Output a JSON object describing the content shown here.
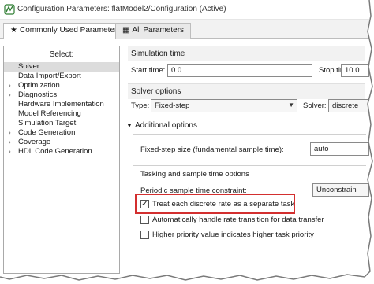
{
  "window": {
    "title": "Configuration Parameters: flatModel2/Configuration (Active)"
  },
  "tabs": [
    {
      "label": "Commonly Used Parameters",
      "glyph": "★",
      "icon": "star-icon"
    },
    {
      "label": "All Parameters",
      "glyph": "▦",
      "icon": "grid-icon"
    }
  ],
  "tree": {
    "header": "Select:",
    "items": [
      {
        "label": "Solver",
        "expandable": false,
        "selected": true
      },
      {
        "label": "Data Import/Export",
        "expandable": false
      },
      {
        "label": "Optimization",
        "expandable": true
      },
      {
        "label": "Diagnostics",
        "expandable": true
      },
      {
        "label": "Hardware Implementation",
        "expandable": false
      },
      {
        "label": "Model Referencing",
        "expandable": false
      },
      {
        "label": "Simulation Target",
        "expandable": false
      },
      {
        "label": "Code Generation",
        "expandable": true
      },
      {
        "label": "Coverage",
        "expandable": true
      },
      {
        "label": "HDL Code Generation",
        "expandable": true
      }
    ]
  },
  "simulation_time": {
    "header": "Simulation time",
    "start_label": "Start time:",
    "start_value": "0.0",
    "stop_label": "Stop time:",
    "stop_value": "10.0"
  },
  "solver_options": {
    "header": "Solver options",
    "type_label": "Type:",
    "type_value": "Fixed-step",
    "solver_label": "Solver:",
    "solver_value": "discrete"
  },
  "additional_options": {
    "header": "Additional options",
    "step_size_label": "Fixed-step size (fundamental sample time):",
    "step_size_value": "auto"
  },
  "tasking": {
    "header": "Tasking and sample time options",
    "constraint_label": "Periodic sample time constraint:",
    "constraint_value": "Unconstrain",
    "checkboxes": [
      {
        "label": "Treat each discrete rate as a separate task",
        "checked": true
      },
      {
        "label": "Automatically handle rate transition for data transfer",
        "checked": false
      },
      {
        "label": "Higher priority value indicates higher task priority",
        "checked": false
      }
    ]
  },
  "colors": {
    "highlight": "#d32f2f",
    "selected_row": "#dcdcdc",
    "group_header": "#f2f2f2"
  }
}
